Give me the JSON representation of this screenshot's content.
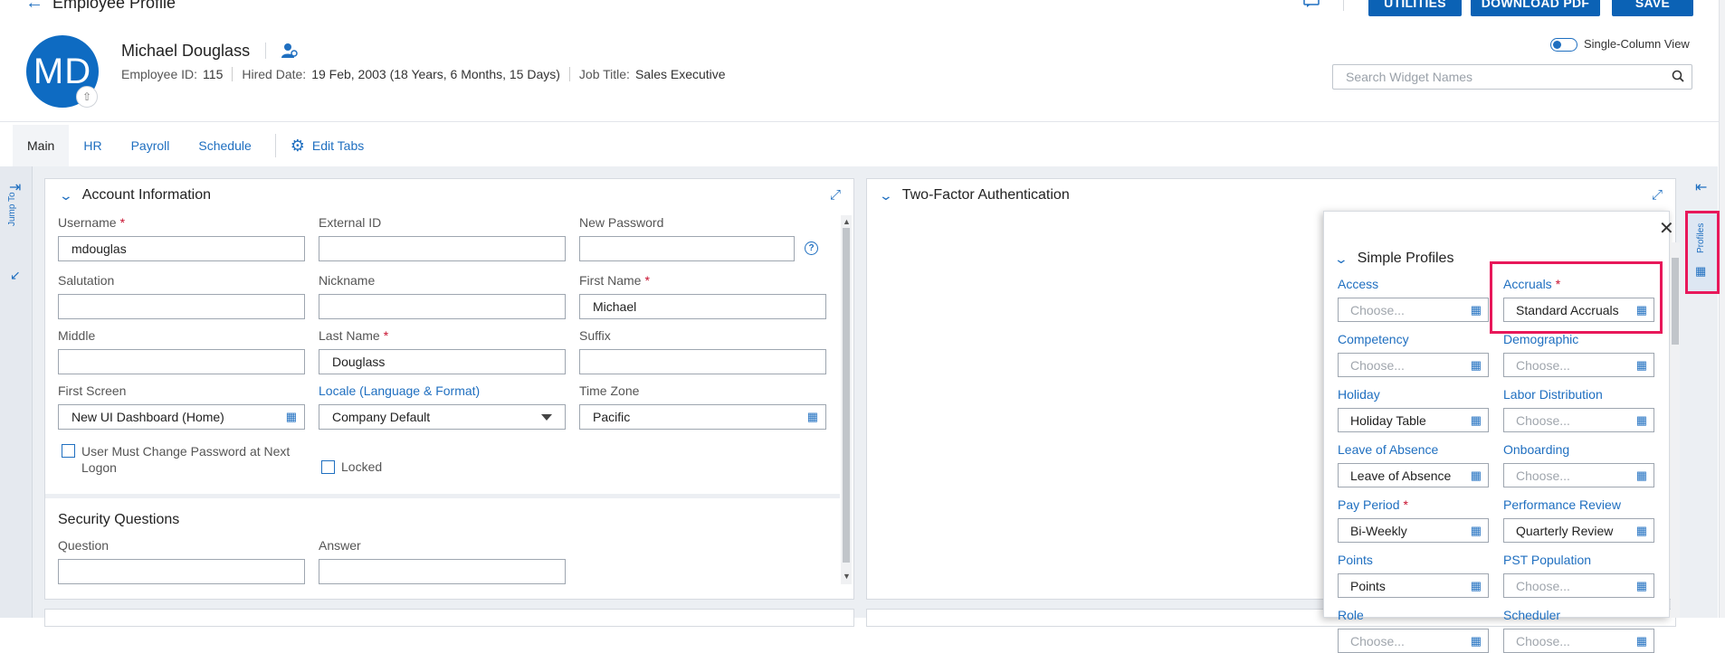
{
  "page": {
    "back_title": "Employee Profile",
    "buttons": {
      "utilities": "UTILITIES",
      "download_pdf": "DOWNLOAD PDF",
      "save": "SAVE"
    }
  },
  "employee": {
    "initials": "MD",
    "name": "Michael Douglass",
    "id_label": "Employee ID:",
    "id_value": "115",
    "hired_label": "Hired Date:",
    "hired_value": "19 Feb, 2003 (18 Years, 6 Months, 15 Days)",
    "job_label": "Job Title:",
    "job_value": "Sales Executive"
  },
  "view_toggle": {
    "label": "Single-Column View"
  },
  "widget_search": {
    "placeholder": "Search Widget Names"
  },
  "tabs": [
    {
      "label": "Main",
      "active": true
    },
    {
      "label": "HR"
    },
    {
      "label": "Payroll"
    },
    {
      "label": "Schedule"
    }
  ],
  "edit_tabs_label": "Edit Tabs",
  "left_rail": {
    "jump_to": "Jump To"
  },
  "account_info": {
    "title": "Account Information",
    "fields": {
      "username": {
        "label": "Username",
        "value": "mdouglas"
      },
      "external_id": {
        "label": "External ID",
        "value": ""
      },
      "new_password": {
        "label": "New Password",
        "value": ""
      },
      "salutation": {
        "label": "Salutation",
        "value": ""
      },
      "nickname": {
        "label": "Nickname",
        "value": ""
      },
      "first_name": {
        "label": "First Name",
        "value": "Michael"
      },
      "middle": {
        "label": "Middle",
        "value": ""
      },
      "last_name": {
        "label": "Last Name",
        "value": "Douglass"
      },
      "suffix": {
        "label": "Suffix",
        "value": ""
      },
      "first_screen": {
        "label": "First Screen",
        "value": "New UI Dashboard (Home)"
      },
      "locale": {
        "label": "Locale (Language & Format)",
        "value": "Company Default"
      },
      "time_zone": {
        "label": "Time Zone",
        "value": "Pacific"
      }
    },
    "must_change_password": {
      "label_line1": "User Must Change Password at Next",
      "label_line2": "Logon",
      "checked": false
    },
    "locked": {
      "label": "Locked",
      "checked": false
    },
    "security_questions": {
      "title": "Security Questions",
      "question_label": "Question",
      "answer_label": "Answer"
    }
  },
  "two_factor": {
    "title": "Two-Factor Authentication"
  },
  "profiles_panel": {
    "tab_label": "Profiles",
    "title": "Simple Profiles",
    "placeholder": "Choose...",
    "items": [
      {
        "label": "Access",
        "value": "",
        "required": false
      },
      {
        "label": "Accruals",
        "value": "Standard Accruals",
        "required": true
      },
      {
        "label": "Competency",
        "value": "",
        "required": false
      },
      {
        "label": "Demographic",
        "value": "",
        "required": false
      },
      {
        "label": "Holiday",
        "value": "Holiday Table",
        "required": false
      },
      {
        "label": "Labor Distribution",
        "value": "",
        "required": false
      },
      {
        "label": "Leave of Absence",
        "value": "Leave of Absence",
        "required": false
      },
      {
        "label": "Onboarding",
        "value": "",
        "required": false
      },
      {
        "label": "Pay Period",
        "value": "Bi-Weekly",
        "required": true
      },
      {
        "label": "Performance Review",
        "value": "Quarterly Review",
        "required": false
      },
      {
        "label": "Points",
        "value": "Points",
        "required": false
      },
      {
        "label": "PST Population",
        "value": "",
        "required": false
      },
      {
        "label": "Role",
        "value": "",
        "required": false
      },
      {
        "label": "Scheduler",
        "value": "",
        "required": false
      }
    ]
  },
  "colors": {
    "accent": "#0b62b5",
    "link": "#1f6fc0",
    "highlight": "#e8185a",
    "required": "#c8102e"
  },
  "icons": [
    "back-arrow-icon",
    "chat-icon",
    "user-settings-icon",
    "upload-icon",
    "search-icon",
    "gear-icon",
    "expand-icon",
    "chevron-down-icon",
    "help-icon",
    "lookup-icon",
    "close-icon",
    "collapse-left-icon",
    "expand-left-icon",
    "profiles-icon"
  ]
}
